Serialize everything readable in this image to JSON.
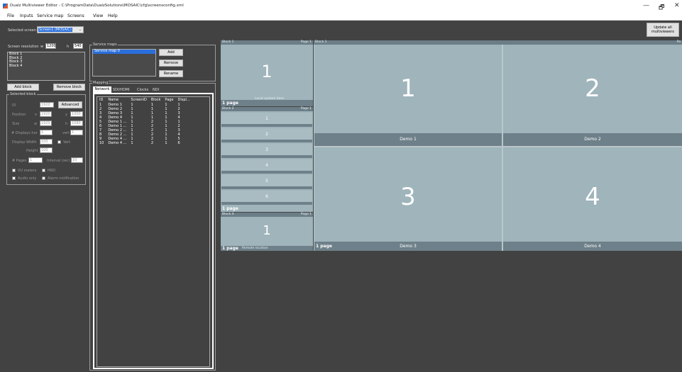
{
  "window": {
    "title": "Dualz Multiviewer Editor - C:\\ProgramData\\DualzSolutions\\MOSAIC\\cfg\\screensconfig.xml",
    "minimize": "—",
    "maximize": "🗗",
    "close": "✕"
  },
  "menu": [
    "File",
    "Inputs",
    "Service map",
    "Screens",
    "View",
    "Help"
  ],
  "top": {
    "selected_screen_label": "Selected screen",
    "selected_screen_value": "Screen1 (MOSAIC)",
    "update_btn_line1": "Update all",
    "update_btn_line2": "multiviewers"
  },
  "left": {
    "resolution_label": "Screen resolution",
    "w_label": "w",
    "w_value": "1200",
    "h_label": "h",
    "h_value": "540",
    "blocks": [
      "Block 1",
      "Block 2",
      "Block 3",
      "Block 4"
    ],
    "add_block": "Add block",
    "remove_block": "Remove block",
    "selected_block": "Selected block",
    "id_label": "ID",
    "id_value": "1920",
    "advanced": "Advanced",
    "position_label": "Position",
    "x_label": "x",
    "x_value": "1920",
    "y_label": "y",
    "y_value": "1000",
    "size_label": "Size",
    "sw_label": "w",
    "sw_value": "1920",
    "sh_label": "h",
    "sh_value": "1080",
    "displays_hor_label": "# Displays hor",
    "displays_hor_value": "1",
    "vert_label": "vert",
    "vert_value": "1",
    "display_width_label": "Display Width",
    "display_width_value": "100",
    "vert_cb_label": "Vert",
    "height_label": "Height",
    "height_value": "100",
    "pages_label": "# Pages",
    "pages_value": "1",
    "interval_label": "Interval (sec)",
    "interval_value": "10",
    "vu_meters": "VU meters",
    "hrd": "HRD",
    "audio_only": "Audio only",
    "alarm": "Alarm notification"
  },
  "service": {
    "group": "Service maps",
    "selected": "Service map 0",
    "add": "Add",
    "remove": "Remove",
    "rename": "Rename"
  },
  "mapping": {
    "group": "Mapping",
    "tabs": [
      "Network",
      "SDI/HDMI",
      "Clocks",
      "NDI"
    ],
    "headers": [
      "ID",
      "Name",
      "ScreenID",
      "Block",
      "Page",
      "Displ..."
    ],
    "rows": [
      [
        "1",
        "Demo 1",
        "1",
        "1",
        "1",
        "1"
      ],
      [
        "2",
        "Demo 2",
        "1",
        "1",
        "1",
        "2"
      ],
      [
        "3",
        "Demo 3",
        "1",
        "1",
        "1",
        "3"
      ],
      [
        "4",
        "Demo 4",
        "1",
        "1",
        "1",
        "4"
      ],
      [
        "5",
        "Demo 1 ...",
        "1",
        "2",
        "1",
        "1"
      ],
      [
        "6",
        "Demo 1 ...",
        "1",
        "2",
        "1",
        "2"
      ],
      [
        "7",
        "Demo 2 ...",
        "1",
        "2",
        "1",
        "3"
      ],
      [
        "8",
        "Demo 2 ...",
        "1",
        "2",
        "1",
        "4"
      ],
      [
        "9",
        "Demo 4 ...",
        "1",
        "2",
        "1",
        "5"
      ],
      [
        "10",
        "Demo 4 ...",
        "1",
        "2",
        "1",
        "6"
      ]
    ]
  },
  "preview": {
    "block1": {
      "hdr": "Block 1",
      "page": "Page 1",
      "num": "1",
      "pages": "1 page",
      "caption": "Local system time"
    },
    "block2": {
      "hdr": "Block 2",
      "page": "Page 1",
      "nums": [
        "1",
        "2",
        "3",
        "4",
        "5",
        "6"
      ],
      "pages": "1 page"
    },
    "block4": {
      "hdr": "Block 4",
      "page": "Page 1",
      "num": "1",
      "pages": "1 page",
      "caption": "Remote location"
    },
    "block_main": {
      "hdr": "Block 1",
      "page": "Pa",
      "pages": "1 page",
      "tiles": [
        {
          "num": "1",
          "label": "Demo 1"
        },
        {
          "num": "2",
          "label": "Demo 2"
        },
        {
          "num": "3",
          "label": "Demo 3"
        },
        {
          "num": "4",
          "label": "Demo 4"
        }
      ]
    }
  }
}
